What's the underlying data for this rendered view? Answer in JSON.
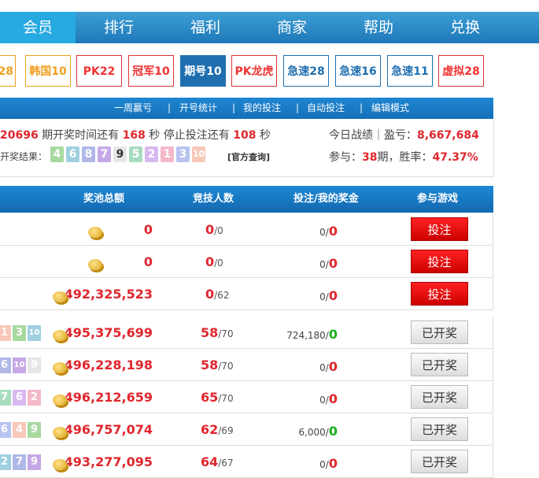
{
  "nav": [
    "会员",
    "排行",
    "福利",
    "商家",
    "帮助",
    "兑换"
  ],
  "tabs": [
    {
      "label": "28",
      "style": "orange"
    },
    {
      "label": "韩国10",
      "style": "orange"
    },
    {
      "label": "PK22",
      "style": "red"
    },
    {
      "label": "冠军10",
      "style": "red"
    },
    {
      "label": "期号10",
      "style": "active"
    },
    {
      "label": "PK龙虎",
      "style": "red"
    },
    {
      "label": "急速28",
      "style": "blue"
    },
    {
      "label": "急速16",
      "style": "blue"
    },
    {
      "label": "急速11",
      "style": "blue"
    },
    {
      "label": "虚拟28",
      "style": "red"
    }
  ],
  "subnav": [
    "一周赢亏",
    "|",
    "开号统计",
    "|",
    "我的投注",
    "|",
    "自动投注",
    "|",
    "编辑模式"
  ],
  "info": {
    "issue_prefix": "20696",
    "issue_text1": " 期开奖时间还有 ",
    "seconds1": "168",
    "issue_text2": " 秒 停止投注还有 ",
    "seconds2": "108",
    "issue_text3": " 秒",
    "result_label": "开奖结果：",
    "result_balls": [
      "4",
      "6",
      "8",
      "7",
      "9",
      "5",
      "2",
      "1",
      "3",
      "10"
    ],
    "official_link": "[官方查询]",
    "today_label": "今日战绩｜盈亏：",
    "today_profit": "8,667,684",
    "join_label": "参与：",
    "join_count": "38",
    "join_unit": "期，胜率：",
    "win_rate": "47.37%"
  },
  "table": {
    "headers": [
      "奖池总额",
      "竞技人数",
      "投注/我的奖金",
      "参与游戏"
    ],
    "rows": [
      {
        "balls": [],
        "pool": "0",
        "players": "0",
        "players_max": "/0",
        "bet": "0/",
        "bonus": "0",
        "bonus_color": "r",
        "action": "投注"
      },
      {
        "balls": [],
        "pool": "0",
        "players": "0",
        "players_max": "/0",
        "bet": "0/",
        "bonus": "0",
        "bonus_color": "r",
        "action": "投注"
      },
      {
        "balls": [],
        "pool": "492,325,523",
        "players": "0",
        "players_max": "/62",
        "bet": "0/",
        "bonus": "0",
        "bonus_color": "r",
        "action": "投注"
      },
      {
        "balls": [
          "1",
          "3",
          "10"
        ],
        "pool": "495,375,699",
        "players": "58",
        "players_max": "/70",
        "bet": "724,180/",
        "bonus": "0",
        "bonus_color": "g",
        "action": "已开奖"
      },
      {
        "balls": [
          "6",
          "10",
          "9"
        ],
        "pool": "496,228,198",
        "players": "58",
        "players_max": "/70",
        "bet": "0/",
        "bonus": "0",
        "bonus_color": "r",
        "action": "已开奖"
      },
      {
        "balls": [
          "7",
          "6",
          "2"
        ],
        "pool": "496,212,659",
        "players": "65",
        "players_max": "/70",
        "bet": "0/",
        "bonus": "0",
        "bonus_color": "r",
        "action": "已开奖"
      },
      {
        "balls": [
          "6",
          "4",
          "9"
        ],
        "pool": "496,757,074",
        "players": "62",
        "players_max": "/69",
        "bet": "6,000/",
        "bonus": "0",
        "bonus_color": "g",
        "action": "已开奖"
      },
      {
        "balls": [
          "2",
          "7",
          "9"
        ],
        "pool": "493,277,095",
        "players": "64",
        "players_max": "/67",
        "bet": "0/",
        "bonus": "0",
        "bonus_color": "r",
        "action": "已开奖"
      }
    ]
  },
  "colors": {
    "ball_palette": [
      "#a8d9a0",
      "#9fd0e0",
      "#b0b8e8",
      "#c6a8e6",
      "#e6e6e6",
      "#a8dcc0",
      "#d8b8f0",
      "#f4b8c8",
      "#b8c4f0",
      "#f8c8b8"
    ]
  }
}
